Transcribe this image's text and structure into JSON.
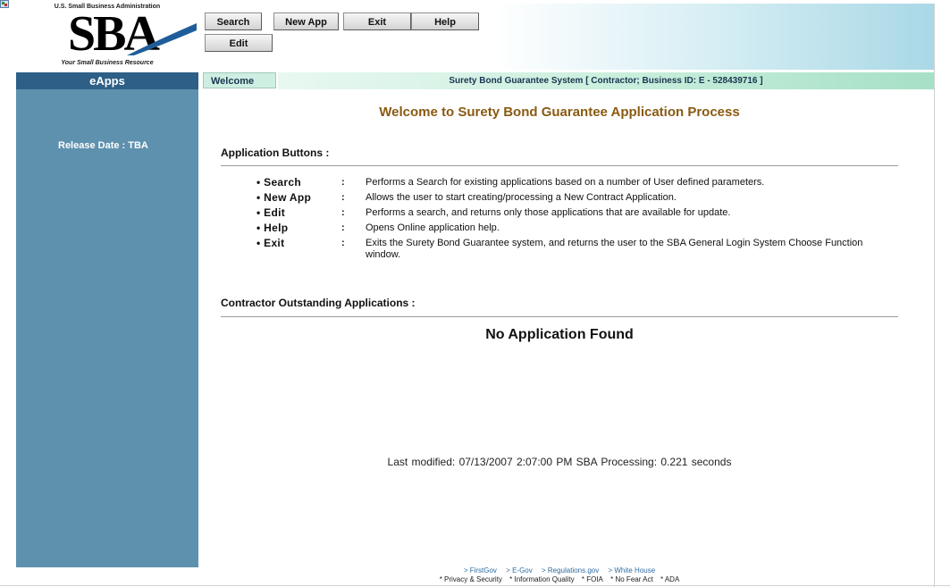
{
  "logo": {
    "top_text": "U.S. Small Business Administration",
    "main": "SBA",
    "tagline": "Your Small Business Resource"
  },
  "nav": {
    "search": "Search",
    "new_app": "New App",
    "exit": "Exit",
    "help": "Help",
    "edit": "Edit"
  },
  "bars": {
    "eapps": "eApps",
    "welcome": "Welcome",
    "status": "Surety Bond Guarantee System   [ Contractor;  Business ID: E - 528439716 ]"
  },
  "sidebar": {
    "release": "Release Date : TBA"
  },
  "main": {
    "title": "Welcome to Surety Bond Guarantee Application Process",
    "app_buttons_heading": "Application Buttons :",
    "buttons": [
      {
        "name": "Search",
        "desc": "Performs a Search for existing applications based on a number of User defined parameters."
      },
      {
        "name": "New App",
        "desc": "Allows the user to start creating/processing a New Contract Application."
      },
      {
        "name": "Edit",
        "desc": "Performs a search, and returns only those applications that are available for update."
      },
      {
        "name": "Help",
        "desc": "Opens Online application help."
      },
      {
        "name": "Exit",
        "desc": "Exits the Surety Bond Guarantee system, and returns the user to the SBA General Login System Choose Function window."
      }
    ],
    "bullet": "•",
    "colon": ":",
    "outstanding_heading": "Contractor Outstanding Applications :",
    "no_app": "No Application Found",
    "last_modified": "Last modified: 07/13/2007 2:07:00 PM   SBA Processing:  0.221 seconds"
  },
  "footer": {
    "links": [
      "> FirstGov",
      "> E-Gov",
      "> Regulations.gov",
      "> White House"
    ],
    "legal": [
      "* Privacy & Security",
      "* Information Quality",
      "* FOIA",
      "* No Fear Act",
      "* ADA"
    ]
  },
  "colors": {
    "sidebar": "#5e91ae",
    "eapps_bar": "#2e5f87",
    "title": "#8a5a12",
    "status_bar": "#c8eedc"
  }
}
